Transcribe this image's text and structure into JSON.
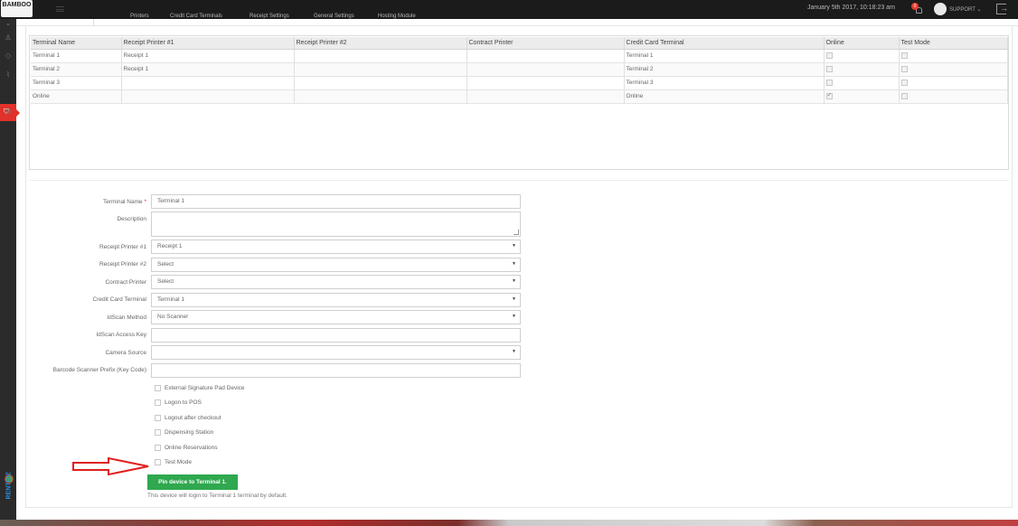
{
  "app": {
    "logo_text": "BAMBOO",
    "logo_sub": ""
  },
  "topbar": {
    "datetime": "January 5th 2017, 10:18:23 am",
    "notification_count": "0",
    "user_label": "SUPPORT ⌄"
  },
  "tabs": [
    "",
    "Printers",
    "Credit Card Terminals",
    "Receipt Settings",
    "General Settings",
    "Hosting Module"
  ],
  "terminals_table": {
    "columns": [
      "Terminal Name",
      "Receipt Printer #1",
      "Receipt Printer #2",
      "Contract Printer",
      "Credit Card Terminal",
      "Online",
      "Test Mode"
    ],
    "rows": [
      {
        "name": "Terminal 1",
        "receipt1": "Receipt 1",
        "receipt2": "",
        "contract": "",
        "cc": "Terminal 1",
        "online": false,
        "test": false
      },
      {
        "name": "Terminal 2",
        "receipt1": "Receipt 1",
        "receipt2": "",
        "contract": "",
        "cc": "Terminal 2",
        "online": false,
        "test": false
      },
      {
        "name": "Terminal 3",
        "receipt1": "",
        "receipt2": "",
        "contract": "",
        "cc": "Terminal 3",
        "online": false,
        "test": false
      },
      {
        "name": "Online",
        "receipt1": "",
        "receipt2": "",
        "contract": "",
        "cc": "Online",
        "online": true,
        "test": false
      }
    ]
  },
  "form": {
    "terminal_name": {
      "label": "Terminal Name",
      "required_mark": "*",
      "value": "Terminal 1"
    },
    "description": {
      "label": "Description",
      "value": ""
    },
    "receipt_printer_1": {
      "label": "Receipt Printer #1",
      "value": "Receipt 1"
    },
    "receipt_printer_2": {
      "label": "Receipt Printer #2",
      "value": "Select"
    },
    "contract_printer": {
      "label": "Contract Printer",
      "value": "Select"
    },
    "credit_card_terminal": {
      "label": "Credit Card Terminal",
      "value": "Terminal 1"
    },
    "idscan_method": {
      "label": "IdScan Method",
      "value": "No Scanner"
    },
    "idscan_access_key": {
      "label": "IdScan Access Key",
      "value": ""
    },
    "camera_source": {
      "label": "Camera Source",
      "value": ""
    },
    "barcode_prefix": {
      "label": "Barcode Scanner Prefix (Key Code)",
      "value": ""
    },
    "checkboxes": [
      {
        "label": "External Signature Pad Device",
        "checked": false
      },
      {
        "label": "Logon to POS",
        "checked": false
      },
      {
        "label": "Logout after checkout",
        "checked": false
      },
      {
        "label": "Dispensing Station",
        "checked": false
      },
      {
        "label": "Online Reservations",
        "checked": false
      },
      {
        "label": "Test Mode",
        "checked": false
      }
    ],
    "pin_button": "Pin device to Terminal 1.",
    "pin_help": "This device will login to Terminal 1 terminal by default."
  },
  "sidebar_icons": [
    "chevron-down-icon",
    "user-icon",
    "tag-icon",
    "chart-icon",
    "shield-icon",
    "gear-icon"
  ],
  "colors": {
    "accent": "#e0322a",
    "pin_button": "#2fa84f",
    "topbar": "#1b1b1b"
  }
}
